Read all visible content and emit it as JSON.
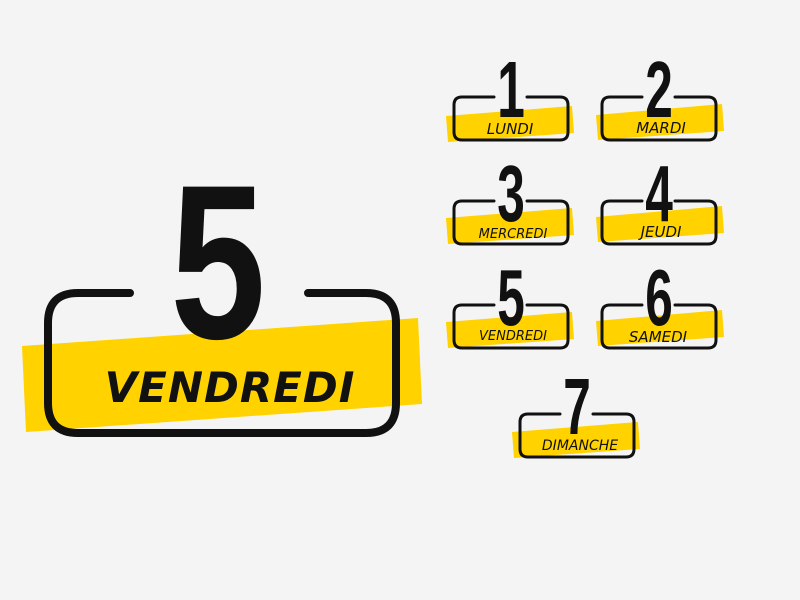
{
  "colors": {
    "accent": "#ffd200",
    "ink": "#111111",
    "background": "#f4f4f4"
  },
  "featured": {
    "number": "5",
    "day": "VENDREDI"
  },
  "days": [
    {
      "number": "1",
      "label": "LUNDI"
    },
    {
      "number": "2",
      "label": "MARDI"
    },
    {
      "number": "3",
      "label": "MERCREDI"
    },
    {
      "number": "4",
      "label": "JEUDI"
    },
    {
      "number": "5",
      "label": "VENDREDI"
    },
    {
      "number": "6",
      "label": "SAMEDI"
    },
    {
      "number": "7",
      "label": "DIMANCHE"
    }
  ]
}
